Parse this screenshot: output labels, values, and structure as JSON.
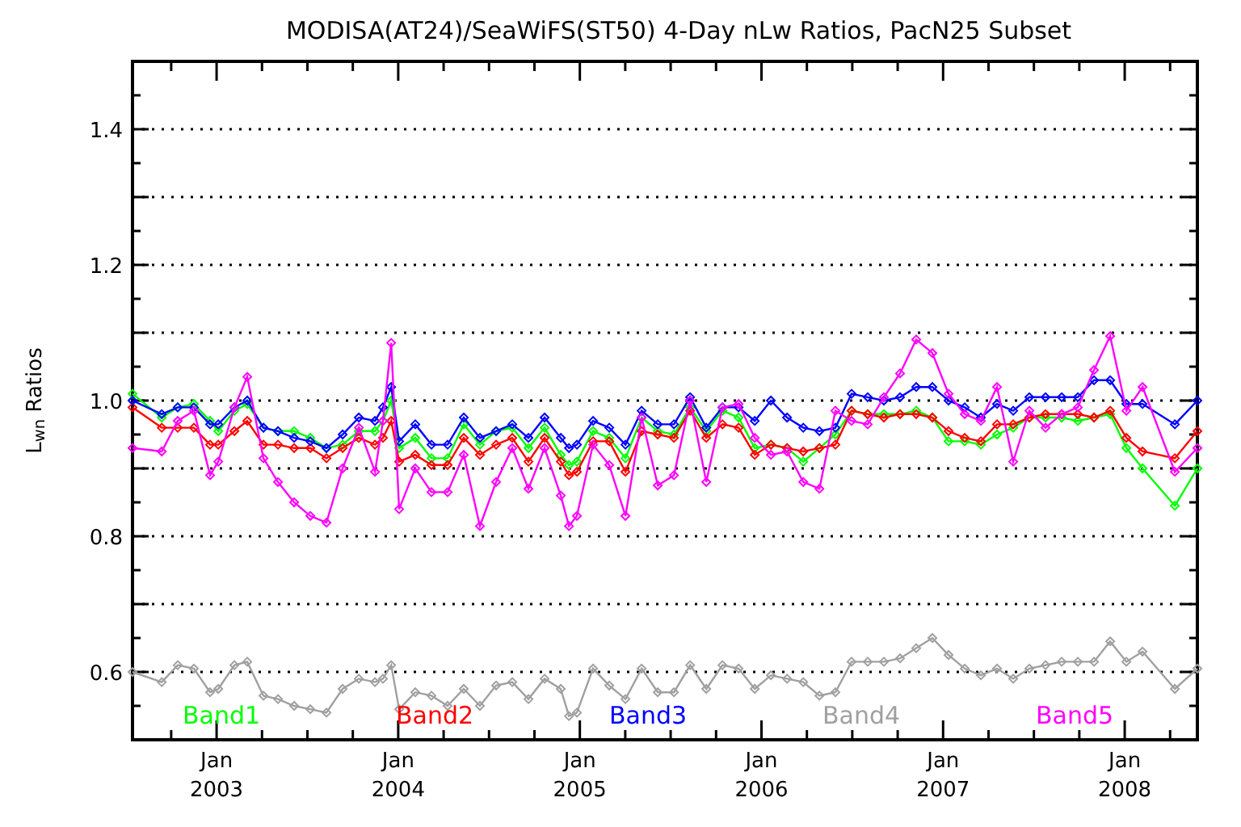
{
  "chart": {
    "chart_data": {
      "type": "line",
      "title": "MODISA(AT24)/SeaWiFS(ST50) 4-Day nLw Ratios, PacN25 Subset",
      "ylabel": "L$_{wn}$ Ratios",
      "x": [
        2002.537,
        2002.698,
        2002.786,
        2002.875,
        2002.964,
        2003.009,
        2003.098,
        2003.169,
        2003.258,
        2003.338,
        2003.427,
        2003.516,
        2003.605,
        2003.694,
        2003.783,
        2003.872,
        2003.916,
        2003.961,
        2004.005,
        2004.094,
        2004.183,
        2004.272,
        2004.361,
        2004.45,
        2004.539,
        2004.628,
        2004.717,
        2004.806,
        2004.895,
        2004.94,
        2004.984,
        2005.073,
        2005.162,
        2005.251,
        2005.34,
        2005.429,
        2005.518,
        2005.607,
        2005.696,
        2005.785,
        2005.874,
        2005.963,
        2006.052,
        2006.141,
        2006.23,
        2006.319,
        2006.407,
        2006.496,
        2006.585,
        2006.674,
        2006.763,
        2006.852,
        2006.941,
        2007.03,
        2007.119,
        2007.208,
        2007.297,
        2007.386,
        2007.475,
        2007.564,
        2007.653,
        2007.742,
        2007.831,
        2007.92,
        2008.009,
        2008.098,
        2008.276,
        2008.4
      ],
      "series": [
        {
          "name": "Band1",
          "color": "#00ff00",
          "marker": "diamond",
          "values": [
            1.01,
            0.975,
            0.99,
            0.995,
            0.97,
            0.955,
            0.985,
            0.995,
            0.96,
            0.955,
            0.955,
            0.945,
            0.93,
            0.935,
            0.955,
            0.955,
            0.97,
            1.0,
            0.93,
            0.945,
            0.915,
            0.915,
            0.965,
            0.935,
            0.955,
            0.96,
            0.93,
            0.96,
            0.92,
            0.905,
            0.91,
            0.955,
            0.945,
            0.915,
            0.975,
            0.955,
            0.95,
            0.99,
            0.955,
            0.985,
            0.975,
            0.93,
            0.935,
            0.93,
            0.91,
            0.93,
            0.95,
            0.985,
            0.98,
            0.98,
            0.98,
            0.985,
            0.975,
            0.94,
            0.94,
            0.935,
            0.95,
            0.96,
            0.975,
            0.975,
            0.975,
            0.97,
            0.975,
            0.98,
            0.93,
            0.9,
            0.845,
            0.9
          ]
        },
        {
          "name": "Band2",
          "color": "#ff0000",
          "marker": "diamond",
          "values": [
            0.99,
            0.96,
            0.96,
            0.96,
            0.935,
            0.935,
            0.955,
            0.97,
            0.935,
            0.935,
            0.93,
            0.93,
            0.915,
            0.93,
            0.945,
            0.935,
            0.945,
            0.97,
            0.91,
            0.92,
            0.905,
            0.905,
            0.945,
            0.92,
            0.935,
            0.945,
            0.91,
            0.945,
            0.91,
            0.89,
            0.895,
            0.94,
            0.94,
            0.895,
            0.955,
            0.95,
            0.945,
            0.985,
            0.945,
            0.965,
            0.96,
            0.92,
            0.935,
            0.93,
            0.925,
            0.93,
            0.935,
            0.985,
            0.98,
            0.975,
            0.98,
            0.98,
            0.975,
            0.955,
            0.945,
            0.94,
            0.965,
            0.965,
            0.975,
            0.98,
            0.98,
            0.98,
            0.975,
            0.985,
            0.945,
            0.925,
            0.915,
            0.955
          ]
        },
        {
          "name": "Band3",
          "color": "#0000ff",
          "marker": "diamond",
          "values": [
            1.0,
            0.98,
            0.99,
            0.99,
            0.965,
            0.965,
            0.99,
            1.0,
            0.96,
            0.955,
            0.945,
            0.94,
            0.93,
            0.95,
            0.975,
            0.97,
            0.99,
            1.02,
            0.94,
            0.965,
            0.935,
            0.935,
            0.975,
            0.945,
            0.955,
            0.965,
            0.945,
            0.975,
            0.945,
            0.93,
            0.935,
            0.97,
            0.96,
            0.935,
            0.985,
            0.965,
            0.965,
            1.005,
            0.96,
            0.99,
            0.99,
            0.97,
            1.0,
            0.975,
            0.96,
            0.955,
            0.96,
            1.01,
            1.005,
            1.0,
            1.005,
            1.02,
            1.02,
            1.0,
            0.99,
            0.975,
            0.995,
            0.985,
            1.005,
            1.005,
            1.005,
            1.005,
            1.03,
            1.03,
            0.995,
            0.995,
            0.965,
            1.0
          ]
        },
        {
          "name": "Band4",
          "color": "#a0a0a0",
          "marker": "diamond",
          "values": [
            0.6,
            0.585,
            0.61,
            0.605,
            0.57,
            0.575,
            0.61,
            0.615,
            0.565,
            0.56,
            0.55,
            0.545,
            0.54,
            0.575,
            0.59,
            0.585,
            0.59,
            0.61,
            0.545,
            0.57,
            0.565,
            0.55,
            0.575,
            0.55,
            0.58,
            0.585,
            0.56,
            0.59,
            0.575,
            0.535,
            0.54,
            0.605,
            0.58,
            0.56,
            0.605,
            0.57,
            0.57,
            0.61,
            0.575,
            0.61,
            0.605,
            0.575,
            0.595,
            0.59,
            0.585,
            0.565,
            0.57,
            0.615,
            0.615,
            0.615,
            0.62,
            0.635,
            0.65,
            0.625,
            0.605,
            0.595,
            0.605,
            0.59,
            0.605,
            0.61,
            0.615,
            0.615,
            0.615,
            0.645,
            0.615,
            0.63,
            0.575,
            0.605
          ]
        },
        {
          "name": "Band5",
          "color": "#ff00ff",
          "marker": "diamond",
          "values": [
            0.93,
            0.925,
            0.97,
            0.985,
            0.89,
            0.91,
            0.99,
            1.035,
            0.915,
            0.88,
            0.85,
            0.83,
            0.82,
            0.9,
            0.96,
            0.895,
            0.97,
            1.085,
            0.84,
            0.9,
            0.865,
            0.865,
            0.92,
            0.815,
            0.88,
            0.93,
            0.87,
            0.93,
            0.86,
            0.815,
            0.83,
            0.935,
            0.905,
            0.83,
            0.975,
            0.875,
            0.89,
            1.0,
            0.88,
            0.99,
            0.995,
            0.945,
            0.92,
            0.925,
            0.88,
            0.87,
            0.985,
            0.97,
            0.965,
            1.005,
            1.04,
            1.09,
            1.07,
            1.01,
            0.98,
            0.97,
            1.02,
            0.91,
            0.985,
            0.96,
            0.98,
            0.99,
            1.045,
            1.095,
            0.985,
            1.02,
            0.895,
            0.93
          ]
        }
      ],
      "xlim": [
        2002.537,
        2008.4
      ],
      "ylim": [
        0.5,
        1.5
      ],
      "xticks": [
        {
          "value": 2003,
          "label": "2003"
        },
        {
          "value": 2004,
          "label": "2004"
        },
        {
          "value": 2005,
          "label": "2005"
        },
        {
          "value": 2006,
          "label": "2006"
        },
        {
          "value": 2007,
          "label": "2007"
        },
        {
          "value": 2008,
          "label": "2008"
        }
      ],
      "annotations": [
        "Jan",
        "Jan",
        "Jan",
        "Jan",
        "Jan",
        "Jan"
      ],
      "grid": true,
      "yticks": [
        {
          "value": 0.6,
          "label": "0.6"
        },
        {
          "value": 0.8,
          "label": "0.8"
        },
        {
          "value": 1.0,
          "label": "1.0"
        },
        {
          "value": 1.2,
          "label": "1.2"
        },
        {
          "value": 1.4,
          "label": "1.4"
        }
      ]
    }
  }
}
